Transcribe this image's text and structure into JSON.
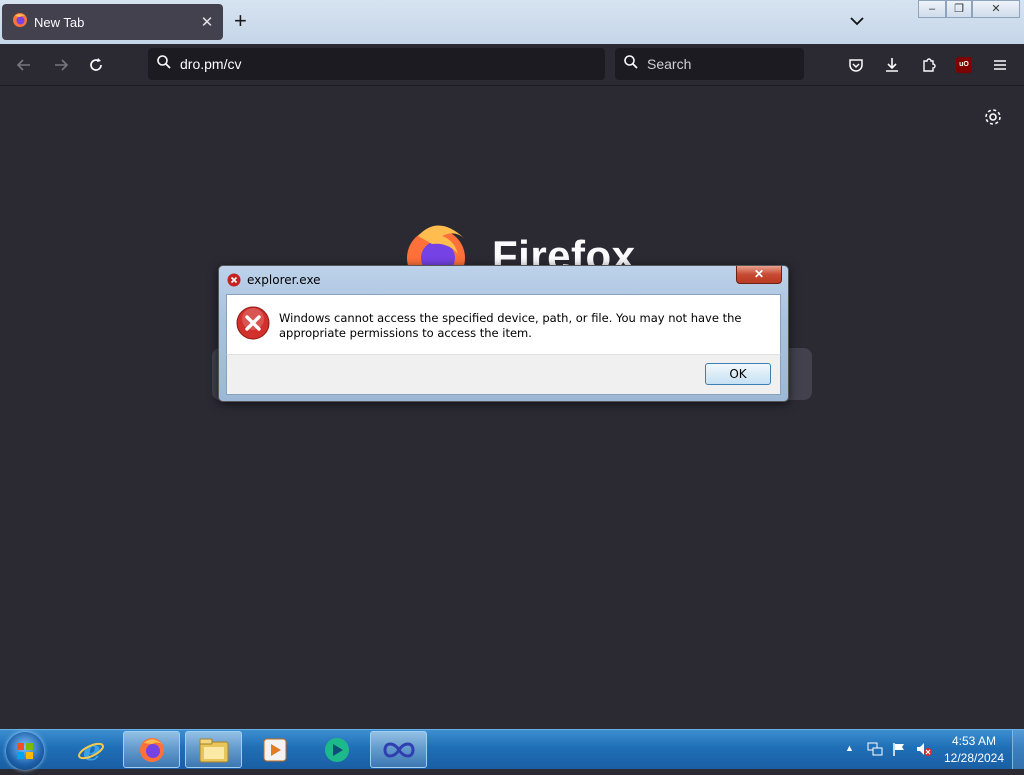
{
  "browser": {
    "tab": {
      "label": "New Tab",
      "close": "✕"
    },
    "new_tab": "+",
    "url": "dro.pm/cv",
    "search_placeholder": "Search",
    "brand_word": "Firefox",
    "extension_badge": "uO"
  },
  "window_controls": {
    "minimize": "–",
    "restore": "❐",
    "close": "✕"
  },
  "dialog": {
    "title": "explorer.exe",
    "close": "✕",
    "message": "Windows cannot access the specified device, path, or file.  You may not have the appropriate permissions to access the item.",
    "ok_label": "OK"
  },
  "taskbar": {
    "items": [
      "internet-explorer-icon",
      "firefox-icon",
      "file-explorer-icon",
      "media-player-icon",
      "app-icon",
      "infinity-app-icon"
    ],
    "tray_arrow": "▲",
    "time": "4:53 AM",
    "date": "12/28/2024"
  },
  "colors": {
    "page_bg": "#2b2a33",
    "toolbar_field": "#1c1b22",
    "taskbar_blue": "#1f6fb7",
    "dialog_error_red": "#c5221f"
  }
}
